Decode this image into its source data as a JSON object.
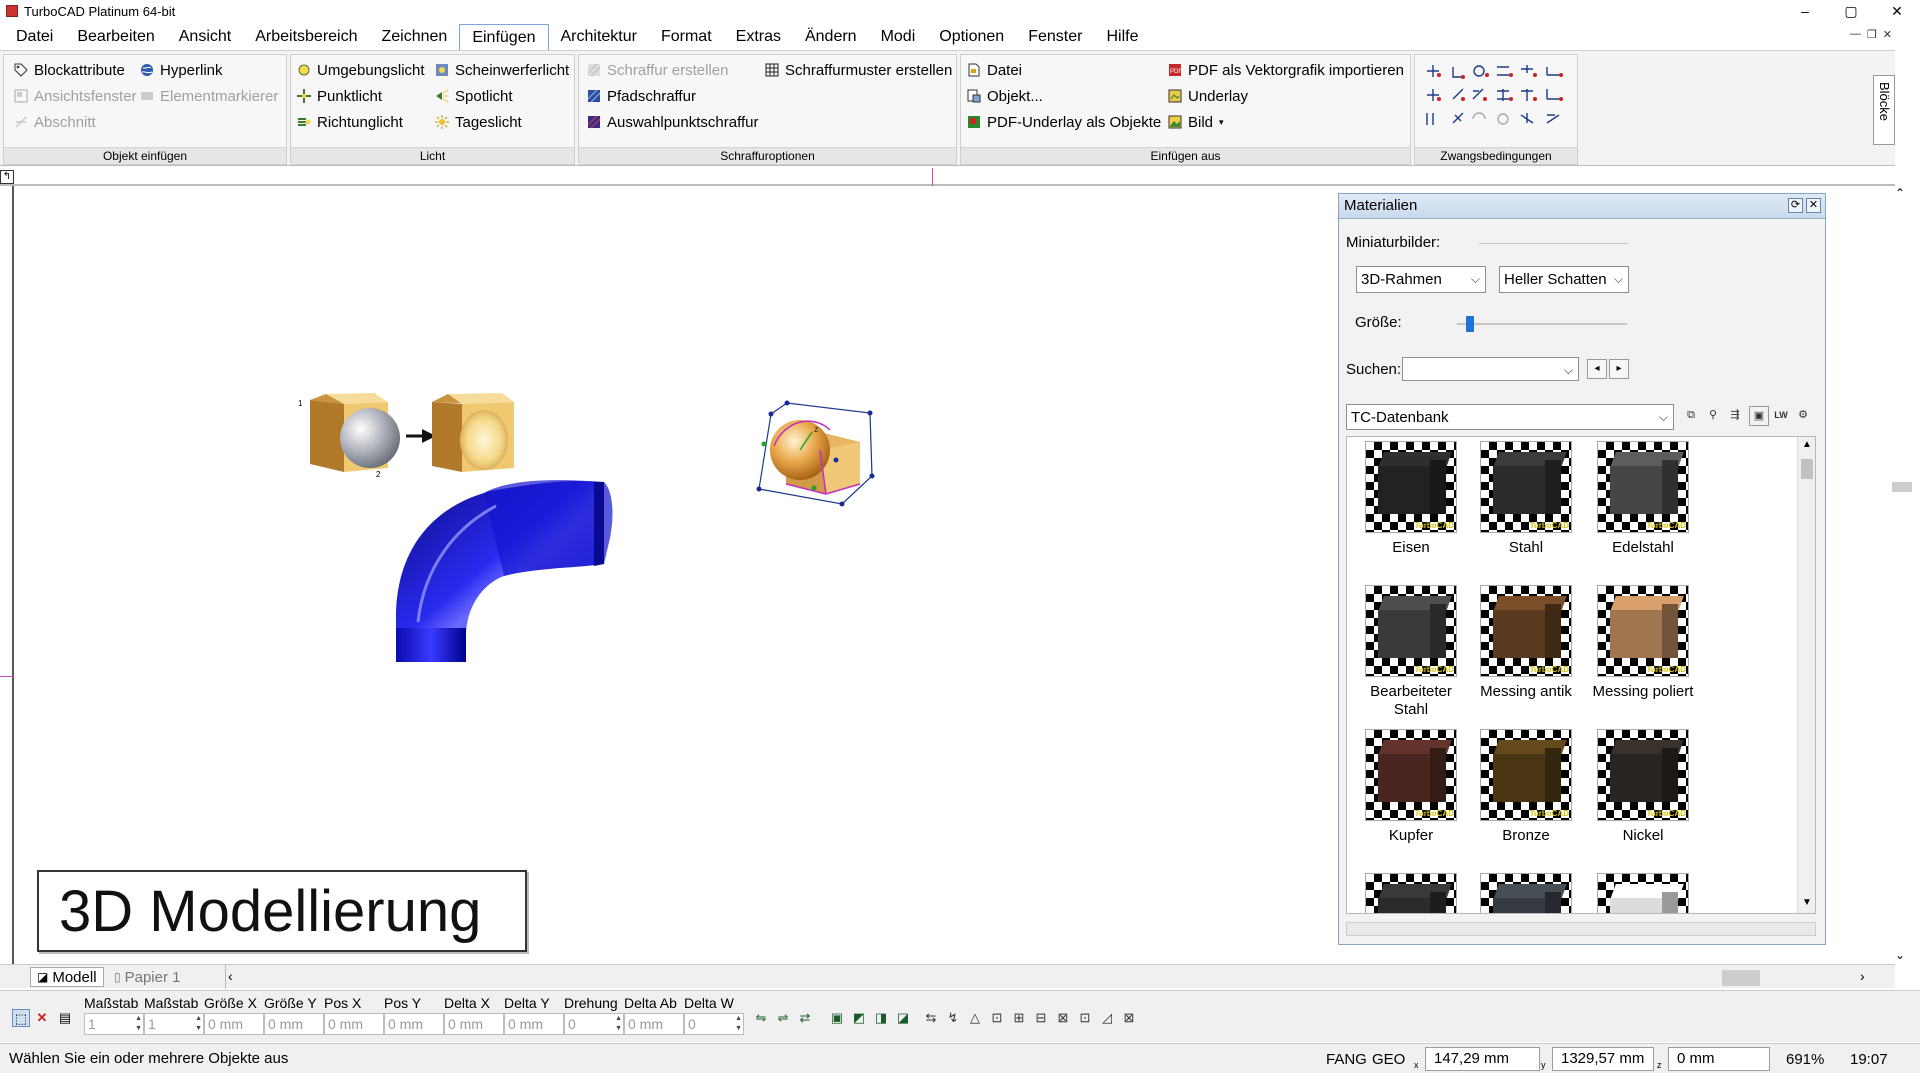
{
  "app": {
    "title": "TurboCAD  Platinum 64-bit"
  },
  "window_buttons": {
    "minimize": "–",
    "maximize": "▢",
    "close": "✕"
  },
  "menu": [
    "Datei",
    "Bearbeiten",
    "Ansicht",
    "Arbeitsbereich",
    "Zeichnen",
    "Einfügen",
    "Architektur",
    "Format",
    "Extras",
    "Ändern",
    "Modi",
    "Optionen",
    "Fenster",
    "Hilfe"
  ],
  "menu_active": "Einfügen",
  "ribbon": {
    "groups": [
      {
        "title": "Objekt einfügen",
        "items": [
          {
            "label": "Blockattribute",
            "icon": "tag-icon",
            "enabled": true
          },
          {
            "label": "Hyperlink",
            "icon": "globe-icon",
            "enabled": true
          },
          {
            "label": "Ansichtsfenster",
            "icon": "viewport-icon",
            "enabled": false
          },
          {
            "label": "Elementmarkierer",
            "icon": "marker-icon",
            "enabled": false
          },
          {
            "label": "Abschnitt",
            "icon": "section-icon",
            "enabled": false
          }
        ]
      },
      {
        "title": "Licht",
        "items": [
          {
            "label": "Umgebungslicht",
            "icon": "ambient-light-icon",
            "enabled": true
          },
          {
            "label": "Scheinwerferlicht",
            "icon": "headlight-icon",
            "enabled": true
          },
          {
            "label": "Punktlicht",
            "icon": "point-light-icon",
            "enabled": true
          },
          {
            "label": "Spotlicht",
            "icon": "spotlight-icon",
            "enabled": true
          },
          {
            "label": "Richtunglicht",
            "icon": "directional-light-icon",
            "enabled": true
          },
          {
            "label": "Tageslicht",
            "icon": "sun-icon",
            "enabled": true
          }
        ]
      },
      {
        "title": "Schraffuroptionen",
        "items": [
          {
            "label": "Schraffur erstellen",
            "icon": "hatch-icon",
            "enabled": false
          },
          {
            "label": "Schraffurmuster erstellen",
            "icon": "hatch-pattern-icon",
            "enabled": true
          },
          {
            "label": "Pfadschraffur",
            "icon": "path-hatch-icon",
            "enabled": true
          },
          {
            "label": "Auswahlpunktschraffur",
            "icon": "pick-point-hatch-icon",
            "enabled": true
          }
        ]
      },
      {
        "title": "Einfügen aus",
        "items": [
          {
            "label": "Datei",
            "icon": "file-icon",
            "enabled": true
          },
          {
            "label": "PDF als Vektorgrafik importieren",
            "icon": "pdf-icon",
            "enabled": true
          },
          {
            "label": "Objekt...",
            "icon": "object-icon",
            "enabled": true
          },
          {
            "label": "Underlay",
            "icon": "underlay-icon",
            "enabled": true
          },
          {
            "label": "PDF-Underlay als Objekte",
            "icon": "pdf-underlay-icon",
            "enabled": true
          },
          {
            "label": "Bild",
            "icon": "image-icon",
            "enabled": true
          }
        ]
      },
      {
        "title": "Zwangsbedingungen",
        "items": []
      }
    ],
    "side_tab": "Blöcke"
  },
  "canvas": {
    "caption": "3D Modellierung",
    "small_label_1": "1",
    "small_label_2": "2"
  },
  "materials": {
    "title": "Materialien",
    "thumbs_label": "Miniaturbilder:",
    "frame_select": "3D-Rahmen",
    "shadow_select": "Heller Schatten",
    "size_label": "Größe:",
    "size_level": 0.05,
    "search_label": "Suchen:",
    "search_value": "",
    "database": "TC-Datenbank",
    "brand_stamp": "TurboCAD",
    "items": [
      {
        "name": "Eisen",
        "color": "#222222"
      },
      {
        "name": "Stahl",
        "color": "#2c2c2c"
      },
      {
        "name": "Edelstahl",
        "color": "#454545"
      },
      {
        "name": "Bearbeiteter Stahl",
        "color": "#3a3a3a"
      },
      {
        "name": "Messing antik",
        "color": "#5a3a1e"
      },
      {
        "name": "Messing poliert",
        "color": "#a07650"
      },
      {
        "name": "Kupfer",
        "color": "#4a2620"
      },
      {
        "name": "Bronze",
        "color": "#4a3614"
      },
      {
        "name": "Nickel",
        "color": "#2a2420"
      },
      {
        "name": "",
        "color": "#2a2a2a"
      },
      {
        "name": "",
        "color": "#353a40"
      },
      {
        "name": "",
        "color": "#dcdcdc"
      }
    ]
  },
  "tabs": {
    "model": "Modell",
    "paper": "Papier 1"
  },
  "inspector": {
    "fields": [
      {
        "label": "Maßstab",
        "value": "1"
      },
      {
        "label": "Maßstab",
        "value": "1"
      },
      {
        "label": "Größe X",
        "value": "0 mm"
      },
      {
        "label": "Größe Y",
        "value": "0 mm"
      },
      {
        "label": "Pos X",
        "value": "0 mm"
      },
      {
        "label": "Pos Y",
        "value": "0 mm"
      },
      {
        "label": "Delta X",
        "value": "0 mm"
      },
      {
        "label": "Delta Y",
        "value": "0 mm"
      },
      {
        "label": "Drehung",
        "value": "0"
      },
      {
        "label": "Delta Ab",
        "value": "0 mm"
      },
      {
        "label": "Delta W",
        "value": "0"
      }
    ]
  },
  "status": {
    "message": "Wählen Sie ein oder mehrere Objekte aus",
    "fang": "FANG",
    "geo": "GEO",
    "x": "147,29 mm",
    "y": "1329,57 mm",
    "z": "0 mm",
    "zoom": "691%",
    "time": "19:07"
  },
  "colors": {
    "accent": "#1e73d8",
    "tube": "#1a1ae0",
    "box": "#e8b560",
    "selection": "#c030c0"
  }
}
